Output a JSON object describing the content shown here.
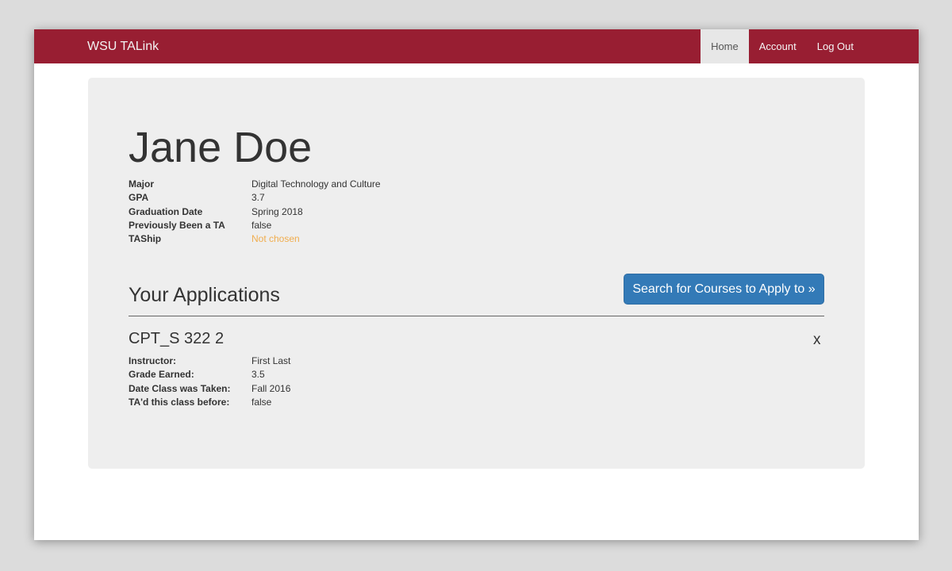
{
  "navbar": {
    "brand": "WSU TALink",
    "items": [
      {
        "label": "Home",
        "active": true
      },
      {
        "label": "Account",
        "active": false
      },
      {
        "label": "Log Out",
        "active": false
      }
    ],
    "color": "#981e32"
  },
  "profile": {
    "name": "Jane Doe",
    "fields": [
      {
        "label": "Major",
        "value": "Digital Technology and Culture"
      },
      {
        "label": "GPA",
        "value": "3.7"
      },
      {
        "label": "Graduation Date",
        "value": "Spring 2018"
      },
      {
        "label": "Previously Been a TA",
        "value": "false"
      },
      {
        "label": "TAShip",
        "value": "Not chosen",
        "status_color": "#f0ad4e"
      }
    ]
  },
  "applications": {
    "heading": "Your Applications",
    "search_button_label": "Search for Courses to Apply to »",
    "items": [
      {
        "course": "CPT_S 322 2",
        "remove_label": "x",
        "fields": [
          {
            "label": "Instructor:",
            "value": "First Last"
          },
          {
            "label": "Grade Earned:",
            "value": "3.5"
          },
          {
            "label": "Date Class was Taken:",
            "value": "Fall 2016"
          },
          {
            "label": "TA'd this class before:",
            "value": "false"
          }
        ]
      }
    ]
  }
}
